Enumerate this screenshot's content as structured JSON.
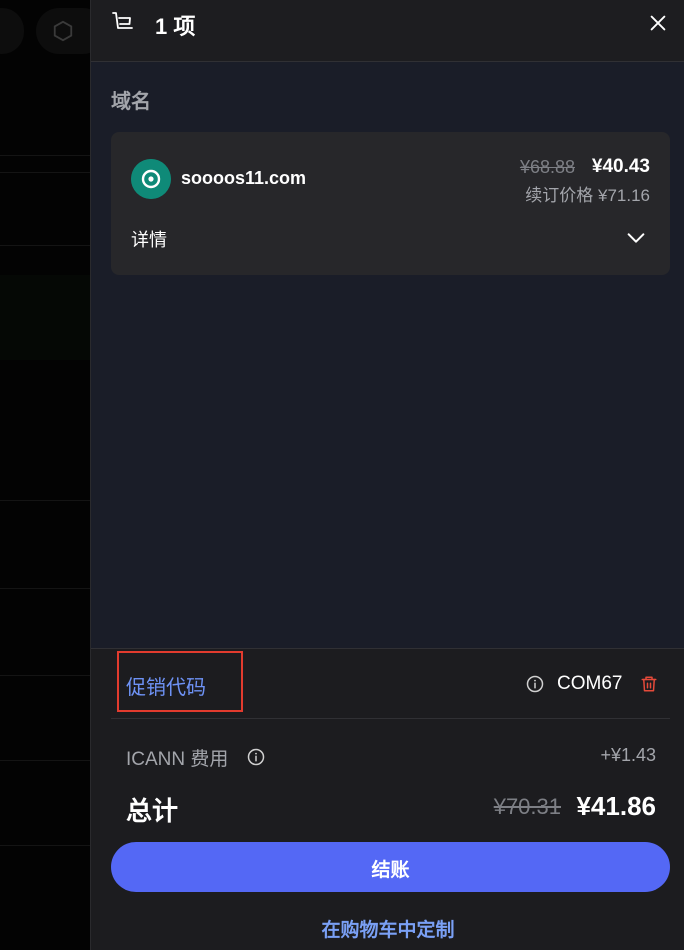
{
  "header": {
    "count_label": "1 项",
    "cart_icon": "cart-icon",
    "close_icon": "close-icon"
  },
  "section": {
    "label": "域名"
  },
  "domain_item": {
    "name": "soooos11.com",
    "original_price": "¥68.88",
    "price": "¥40.43",
    "renewal_label": "续订价格 ¥71.16",
    "details_label": "详情",
    "logo_icon": "domain-logo-icon",
    "logo_color": "#0f8a78"
  },
  "promo": {
    "label": "促销代码",
    "code": "COM67",
    "highlight_color": "#e23b2e"
  },
  "fees": {
    "icann_label": "ICANN 费用",
    "icann_value": "+¥1.43"
  },
  "total": {
    "label": "总计",
    "original": "¥70.31",
    "amount": "¥41.86"
  },
  "actions": {
    "checkout_label": "结账",
    "customize_label": "在购物车中定制"
  },
  "colors": {
    "accent": "#5468f5",
    "link": "#7aa0f5",
    "delete": "#e54a3a"
  }
}
